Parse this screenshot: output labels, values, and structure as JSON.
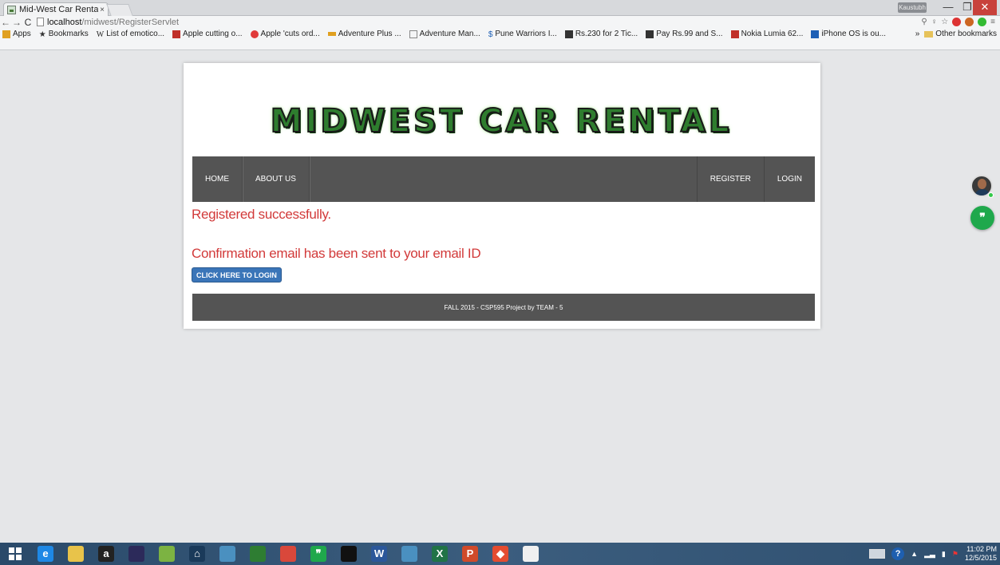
{
  "browser": {
    "tab_title": "Mid-West Car Rental",
    "tab_close": "×",
    "profile_label": "Kaustubh",
    "url_host": "localhost",
    "url_path": "/midwest/RegisterServlet",
    "bookmarks": [
      {
        "label": "Apps",
        "color": "#e0a020"
      },
      {
        "label": "Bookmarks",
        "color": "#333333"
      },
      {
        "label": "List of emotico...",
        "color": "#555555"
      },
      {
        "label": "Apple cutting o...",
        "color": "#c0302a"
      },
      {
        "label": "Apple 'cuts ord...",
        "color": "#e03a3a"
      },
      {
        "label": "Adventure Plus ...",
        "color": "#e0a020"
      },
      {
        "label": "Adventure Man...",
        "color": "#888888"
      },
      {
        "label": "Pune Warriors I...",
        "color": "#1d5fb5"
      },
      {
        "label": "Rs.230 for 2 Tic...",
        "color": "#333333"
      },
      {
        "label": "Pay Rs.99 and S...",
        "color": "#333333"
      },
      {
        "label": "Nokia Lumia 62...",
        "color": "#c0302a"
      },
      {
        "label": "iPhone OS is ou...",
        "color": "#1d5fb5"
      }
    ],
    "bookmarks_more": "»",
    "other_bookmarks": "Other bookmarks"
  },
  "site": {
    "logo_text": "MIDWEST CAR RENTAL",
    "nav": {
      "home": "HOME",
      "about": "ABOUT US",
      "register": "REGISTER",
      "login": "LOGIN"
    },
    "message_registered": "Registered successfully.",
    "message_email": "Confirmation email has been sent to your email ID",
    "login_button": "CLICK HERE TO LOGIN",
    "footer_text": "FALL 2015 - CSP595 Project by TEAM - 5"
  },
  "taskbar": {
    "apps": [
      {
        "name": "internet-explorer",
        "color": "#1e88e5",
        "glyph": "e"
      },
      {
        "name": "file-explorer",
        "color": "#e8c34a",
        "glyph": ""
      },
      {
        "name": "amazon",
        "color": "#222222",
        "glyph": "a"
      },
      {
        "name": "eclipse",
        "color": "#2c2a5a",
        "glyph": ""
      },
      {
        "name": "paint",
        "color": "#7cb342",
        "glyph": ""
      },
      {
        "name": "home",
        "color": "#1a3a5a",
        "glyph": "⌂"
      },
      {
        "name": "photos",
        "color": "#4a90c0",
        "glyph": ""
      },
      {
        "name": "people",
        "color": "#2e7d32",
        "glyph": ""
      },
      {
        "name": "chrome",
        "color": "#d9483b",
        "glyph": ""
      },
      {
        "name": "hangouts",
        "color": "#1fa84c",
        "glyph": "❞"
      },
      {
        "name": "command-prompt",
        "color": "#111111",
        "glyph": ""
      },
      {
        "name": "word",
        "color": "#2b579a",
        "glyph": "W"
      },
      {
        "name": "onenote",
        "color": "#4a90c0",
        "glyph": ""
      },
      {
        "name": "excel",
        "color": "#217346",
        "glyph": "X"
      },
      {
        "name": "powerpoint",
        "color": "#d04a2a",
        "glyph": "P"
      },
      {
        "name": "git",
        "color": "#e44c30",
        "glyph": "◆"
      },
      {
        "name": "java",
        "color": "#f0f0f0",
        "glyph": ""
      }
    ],
    "clock_time": "11:02 PM",
    "clock_date": "12/5/2015"
  }
}
